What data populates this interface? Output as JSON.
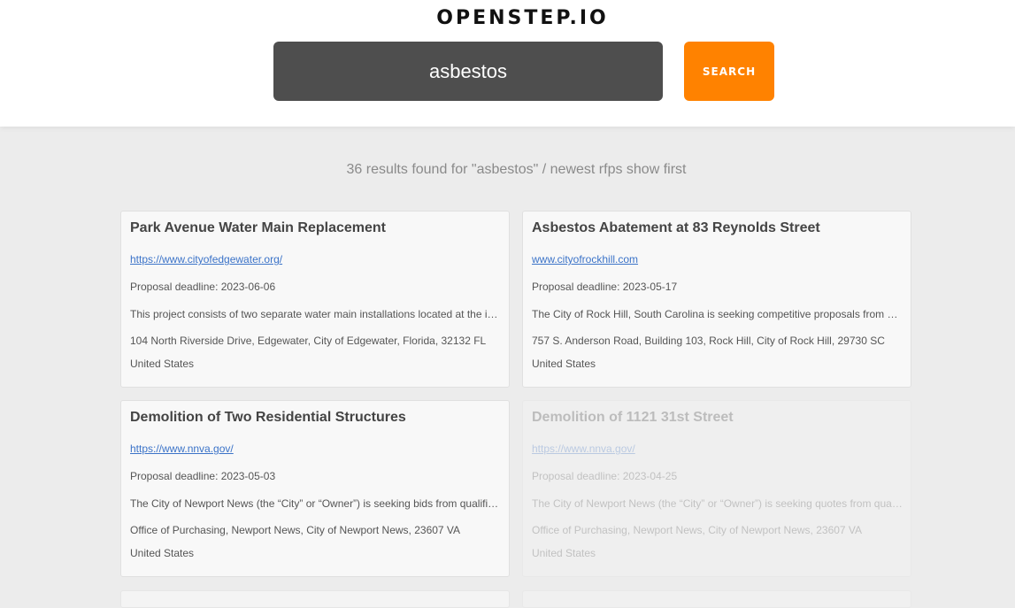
{
  "header": {
    "logo": "OPENSTEP.IO",
    "search_value": "asbestos",
    "search_button": "SEARCH"
  },
  "results_info": "36 results found for \"asbestos\" / newest rfps show first",
  "cards": [
    {
      "title": "Park Avenue Water Main Replacement",
      "link": "https://www.cityofedgewater.org/",
      "deadline": "Proposal deadline: 2023-06-06",
      "description": "This project consists of two separate water main installations located at the i…",
      "address": "104 North Riverside Drive, Edgewater, City of Edgewater, Florida, 32132 FL",
      "country": "United States"
    },
    {
      "title": "Asbestos Abatement at 83 Reynolds Street",
      "link": "www.cityofrockhill.com",
      "deadline": "Proposal deadline: 2023-05-17",
      "description": "The City of Rock Hill, South Carolina is seeking competitive proposals from q…",
      "address": "757 S. Anderson Road, Building 103, Rock Hill, City of Rock Hill, 29730 SC",
      "country": "United States"
    },
    {
      "title": "Demolition of Two Residential Structures",
      "link": "https://www.nnva.gov/",
      "deadline": "Proposal deadline: 2023-05-03",
      "description": "The City of Newport News (the “City” or “Owner”) is seeking bids from qualifie…",
      "address": "Office of Purchasing, Newport News, City of Newport News, 23607 VA",
      "country": "United States"
    },
    {
      "title": "Demolition of 1121 31st Street",
      "link": "https://www.nnva.gov/",
      "deadline": "Proposal deadline: 2023-04-25",
      "description": "The City of Newport News (the “City” or “Owner”) is seeking quotes from quali…",
      "address": "Office of Purchasing, Newport News, City of Newport News, 23607 VA",
      "country": "United States"
    }
  ],
  "colors": {
    "accent": "#ff8200",
    "search_bg": "#4e4e4e",
    "link": "#3b73c8",
    "page_bg": "#ececec"
  }
}
